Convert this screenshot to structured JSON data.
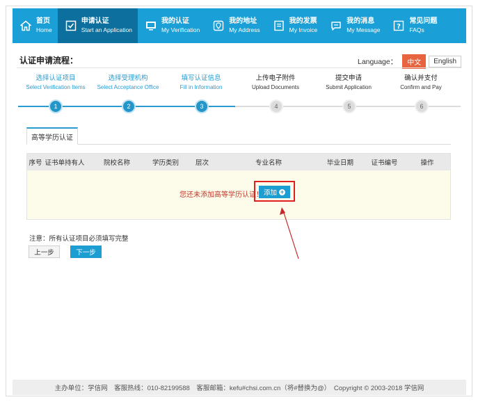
{
  "nav": [
    {
      "cn": "首页",
      "en": "Home",
      "icon": "home-icon",
      "active": false
    },
    {
      "cn": "申请认证",
      "en": "Start an Application",
      "icon": "checkbox-icon",
      "active": true
    },
    {
      "cn": "我的认证",
      "en": "My Verification",
      "icon": "monitor-icon",
      "active": false
    },
    {
      "cn": "我的地址",
      "en": "My Address",
      "icon": "location-icon",
      "active": false
    },
    {
      "cn": "我的发票",
      "en": "My Invoice",
      "icon": "invoice-icon",
      "active": false
    },
    {
      "cn": "我的消息",
      "en": "My Message",
      "icon": "message-icon",
      "active": false
    },
    {
      "cn": "常见问题",
      "en": "FAQs",
      "icon": "question-icon",
      "active": false
    }
  ],
  "header": {
    "title": "认证申请流程：",
    "language_label": "Language：",
    "lang_cn": "中文",
    "lang_en": "English"
  },
  "steps": [
    {
      "cn": "选择认证项目",
      "en": "Select Verification Items",
      "num": "1",
      "state": "done"
    },
    {
      "cn": "选择受理机构",
      "en": "Select Acceptance Office",
      "num": "2",
      "state": "done"
    },
    {
      "cn": "填写认证信息",
      "en": "Fill in Information",
      "num": "3",
      "state": "done"
    },
    {
      "cn": "上传电子附件",
      "en": "Upload Documents",
      "num": "4",
      "state": "todo"
    },
    {
      "cn": "提交申请",
      "en": "Submit Application",
      "num": "5",
      "state": "todo"
    },
    {
      "cn": "确认并支付",
      "en": "Confirm and Pay",
      "num": "6",
      "state": "todo"
    }
  ],
  "tab": {
    "label": "高等学历认证"
  },
  "table": {
    "columns": [
      "序号",
      "证书单持有人",
      "院校名称",
      "学历类别",
      "层次",
      "专业名称",
      "毕业日期",
      "证书编号",
      "操作"
    ],
    "empty_message": "您还未添加高等学历认证！",
    "add_label": "添加"
  },
  "note": "注意：所有认证项目必须填写完整",
  "buttons": {
    "prev": "上一步",
    "next": "下一步"
  },
  "footer": "主办单位：学信网　客服热线：010-82199588　客服邮箱：kefu#chsi.com.cn（将#替换为@）　Copyright © 2003-2018 学信网",
  "colors": {
    "nav": "#1aa0d6",
    "nav_active": "#0c6f9d",
    "accent": "#2a9bd0",
    "highlight": "#e02020"
  }
}
